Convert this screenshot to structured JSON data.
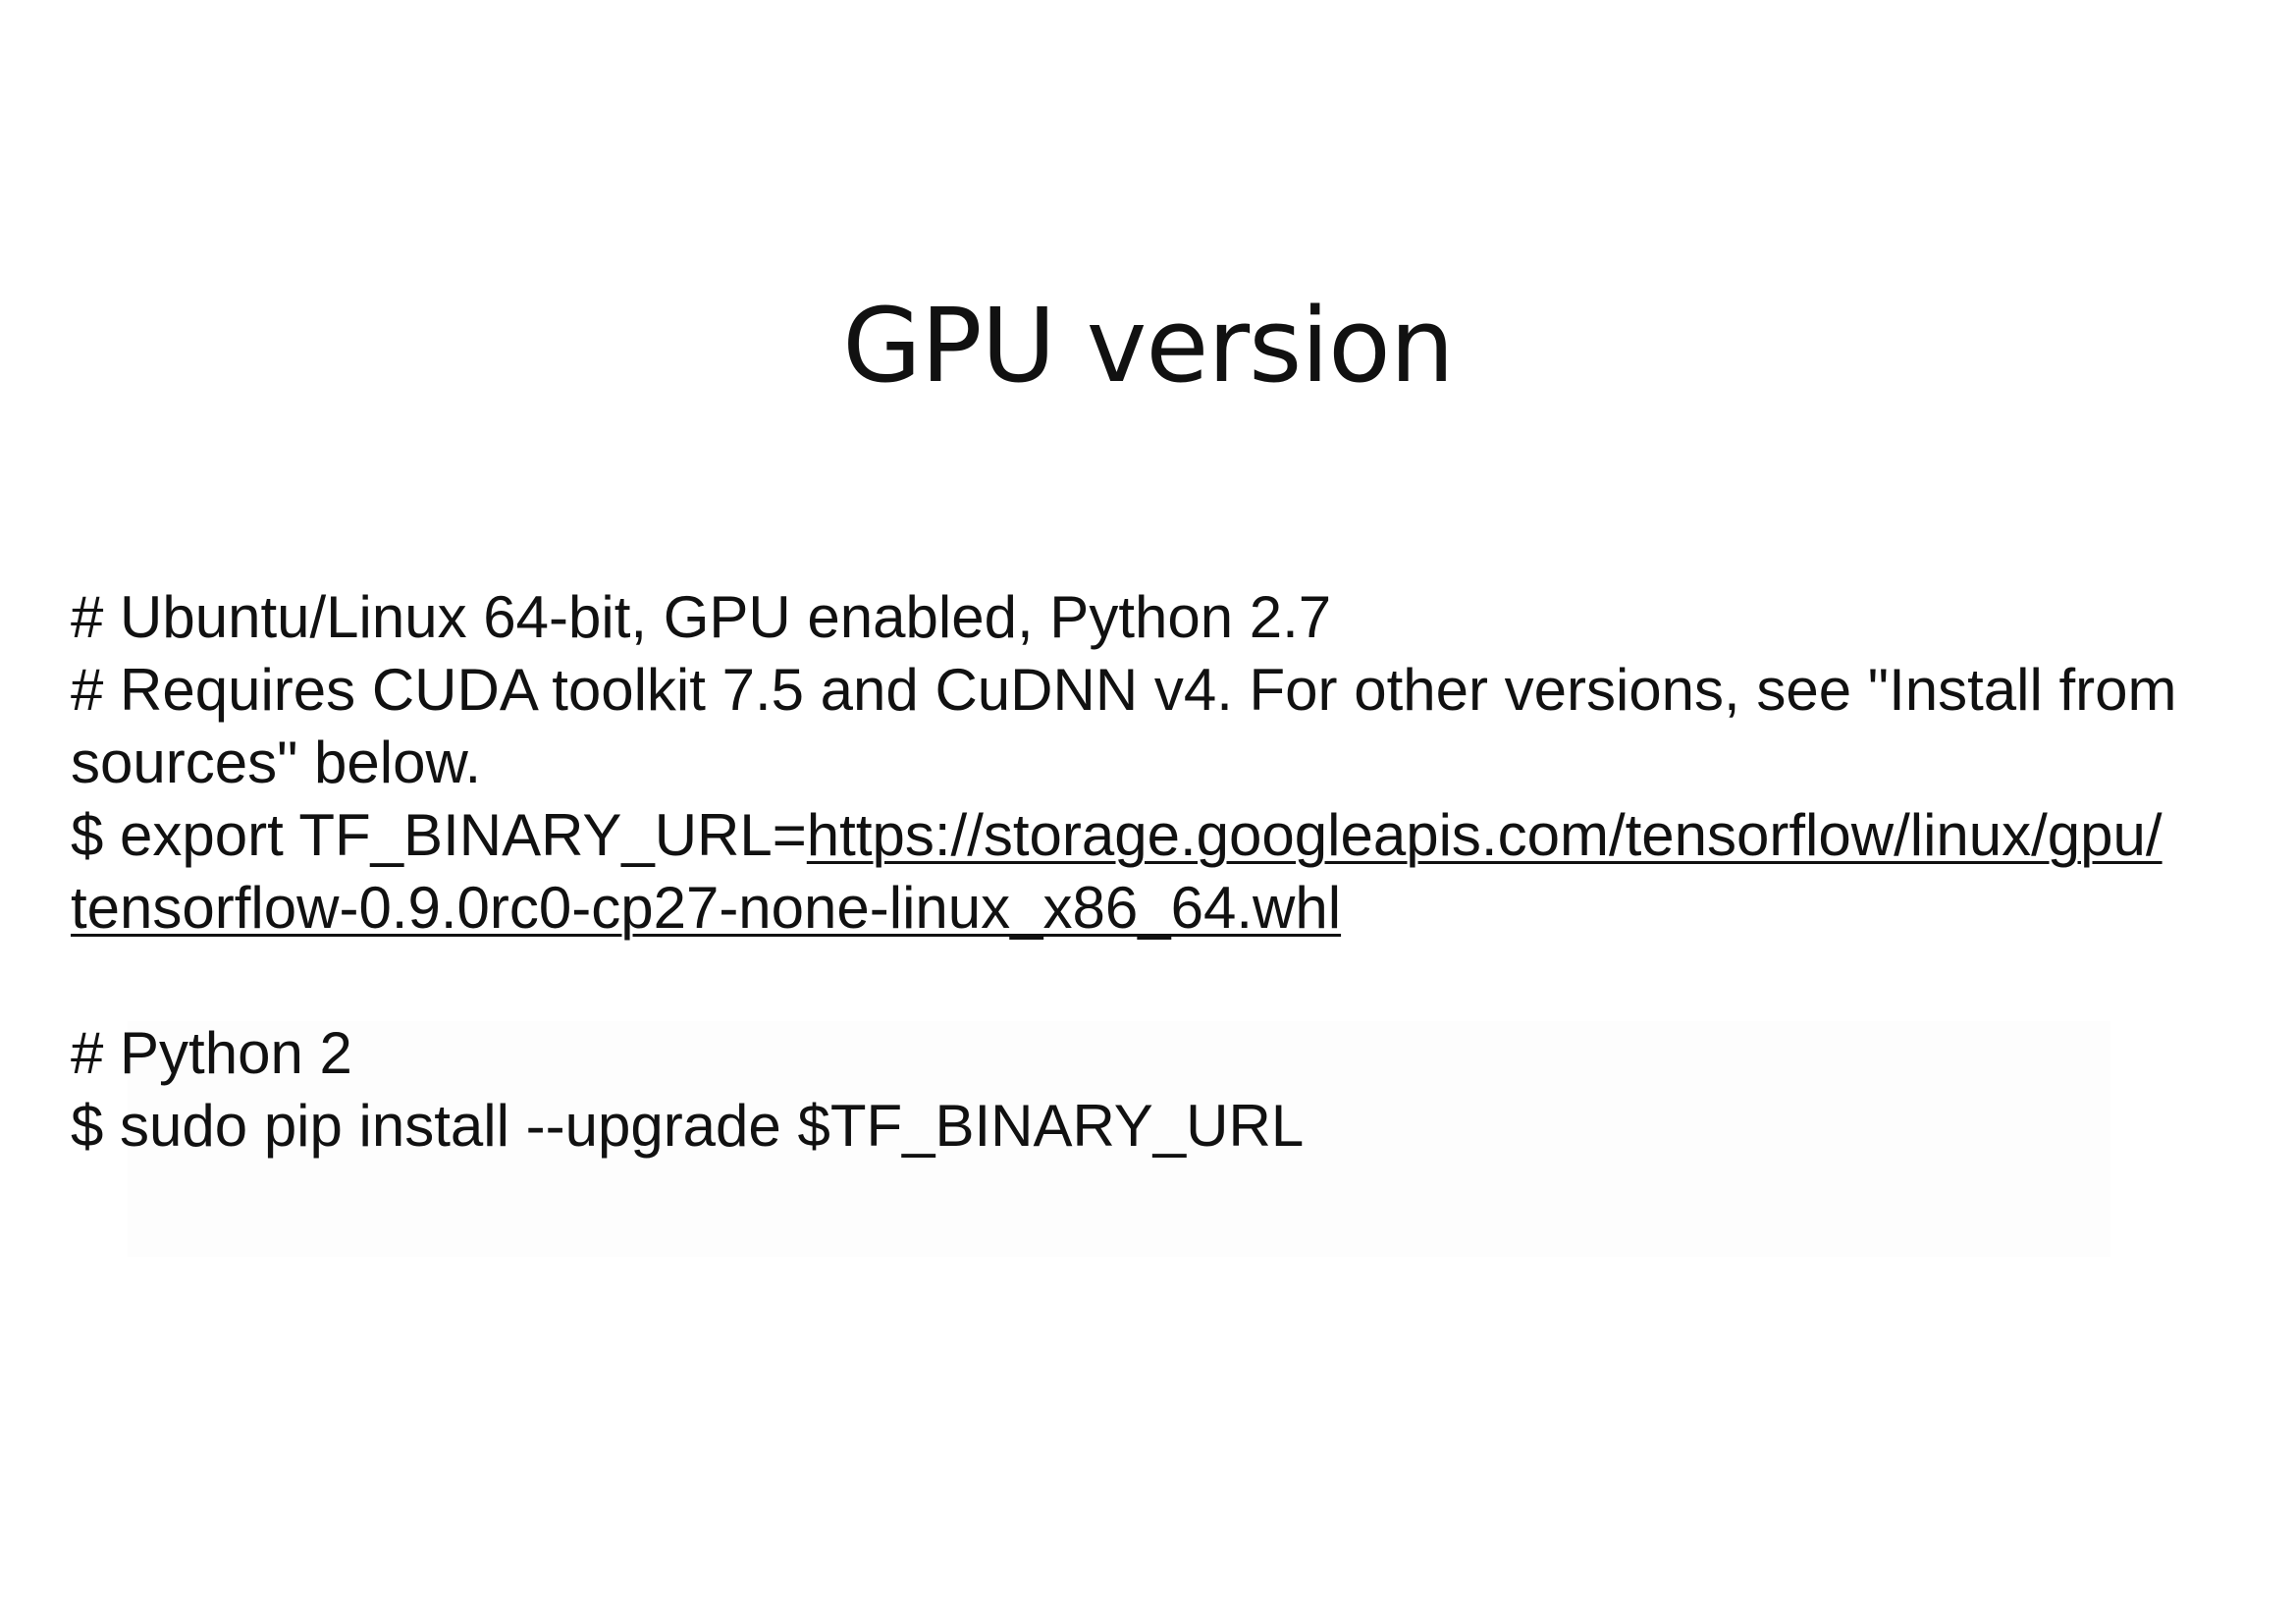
{
  "slide": {
    "title": "GPU version",
    "comment_line_1": "# Ubuntu/Linux 64-bit, GPU enabled, Python 2.7",
    "comment_line_2": "# Requires CUDA toolkit 7.5 and CuDNN v4. For other versions, see \"Install from",
    "comment_line_3": "sources\" below.",
    "export_prefix": "$ export TF_BINARY_URL=",
    "export_url_part_1": "https://storage.googleapis.com/tensorflow/linux/gpu/",
    "export_url_part_2": "tensorflow-0.9.0rc0-cp27-none-linux_x86_64.whl",
    "python_comment": "# Python 2",
    "install_command": "$ sudo pip install --upgrade $TF_BINARY_URL"
  }
}
